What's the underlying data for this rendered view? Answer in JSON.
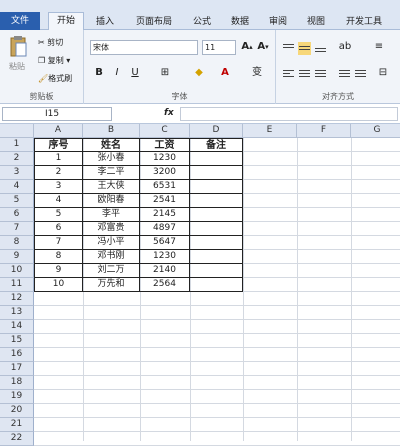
{
  "tabs": [
    "文件",
    "开始",
    "插入",
    "页面布局",
    "公式",
    "数据",
    "审阅",
    "视图",
    "开发工具"
  ],
  "clipboard": {
    "paste": "粘贴",
    "cut": "剪切",
    "copy": "复制",
    "painter": "格式刷",
    "label": "剪贴板"
  },
  "font": {
    "name": "宋体",
    "size": "11",
    "label": "字体"
  },
  "alignment": {
    "label": "对齐方式"
  },
  "formula_bar": {
    "namebox": "I15",
    "fx": "fx",
    "value": ""
  },
  "columns": [
    "A",
    "B",
    "C",
    "D",
    "E",
    "F",
    "G"
  ],
  "rows": [
    "1",
    "2",
    "3",
    "4",
    "5",
    "6",
    "7",
    "8",
    "9",
    "10",
    "11",
    "12",
    "13",
    "14",
    "15",
    "16",
    "17",
    "18",
    "19",
    "20",
    "21",
    "22"
  ],
  "table": {
    "headers": [
      "序号",
      "姓名",
      "工资",
      "备注"
    ],
    "data": [
      [
        "1",
        "张小春",
        "1230",
        ""
      ],
      [
        "2",
        "李二平",
        "3200",
        ""
      ],
      [
        "3",
        "王大侠",
        "6531",
        ""
      ],
      [
        "4",
        "欧阳春",
        "2541",
        ""
      ],
      [
        "5",
        "李平",
        "2145",
        ""
      ],
      [
        "6",
        "邓富贵",
        "4897",
        ""
      ],
      [
        "7",
        "冯小平",
        "5647",
        ""
      ],
      [
        "8",
        "邓书刚",
        "1230",
        ""
      ],
      [
        "9",
        "刘二万",
        "2140",
        ""
      ],
      [
        "10",
        "万先和",
        "2564",
        ""
      ]
    ]
  },
  "colors": {
    "file_tab": "#2a5fae",
    "header_bg": "#dfe6f2",
    "ribbon_bg": "#f1f4f9"
  }
}
